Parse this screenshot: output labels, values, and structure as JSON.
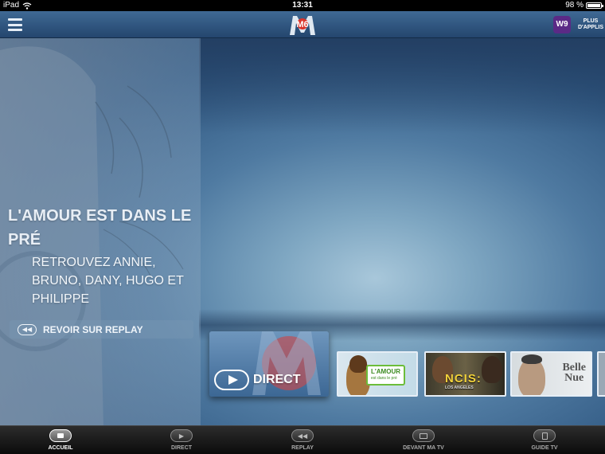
{
  "status_bar": {
    "device": "iPad",
    "time": "13:31",
    "battery": "98 %",
    "battery_level": 0.98
  },
  "header": {
    "logo_text": "M6",
    "w9_label": "W9",
    "more_apps": [
      "PLUS",
      "D'APPLIS"
    ]
  },
  "promo": {
    "title": "L'AMOUR EST DANS LE PRÉ",
    "subtitle": "RETROUVEZ ANNIE, BRUNO, DANY, HUGO ET PHILIPPE",
    "replay_button": "REVOIR SUR REPLAY"
  },
  "carousel": {
    "direct_label": "DIRECT",
    "thumbnails": [
      {
        "name": "l-amour-est-dans-le-pre",
        "tag_lines": [
          "L'AMOUR",
          "est dans le pré"
        ]
      },
      {
        "name": "ncis",
        "tag_lines": [
          "NCIS:",
          "LOS ANGELES"
        ]
      },
      {
        "name": "belle-et-nue",
        "tag_lines": [
          "Belle",
          "Nue"
        ]
      }
    ]
  },
  "tabbar": {
    "tabs": [
      {
        "label": "ACCUEIL",
        "active": true
      },
      {
        "label": "DIRECT",
        "active": false
      },
      {
        "label": "REPLAY",
        "active": false
      },
      {
        "label": "DEVANT MA TV",
        "active": false
      },
      {
        "label": "GUIDE TV",
        "active": false
      }
    ]
  },
  "colors": {
    "header": "#2f5580",
    "accent_m6": "#d9342b",
    "tabbar": "#1a1a1a"
  }
}
